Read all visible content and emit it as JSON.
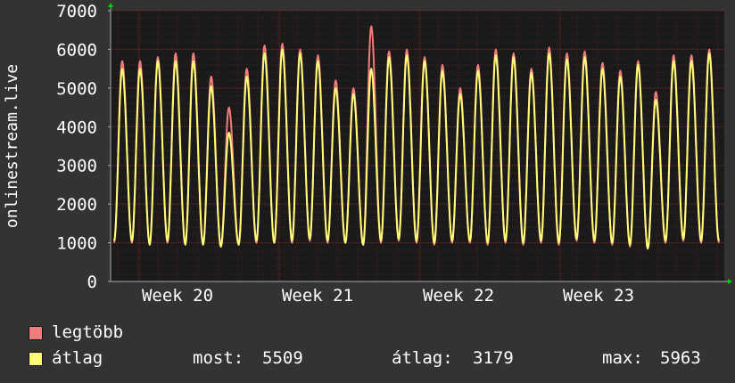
{
  "chart_data": {
    "type": "line",
    "ylabel": "onlinestream.live",
    "ylim": [
      0,
      7000
    ],
    "yticks": [
      0,
      1000,
      2000,
      3000,
      4000,
      5000,
      6000,
      7000
    ],
    "x_tick_labels": [
      "Week 20",
      "Week 21",
      "Week 22",
      "Week 23"
    ],
    "grid": true,
    "colors": {
      "legtobb": "#f47b7b",
      "atlag": "#ffff77",
      "background": "#1a1a1a",
      "grid": "#7a2a2a",
      "axis_arrow": "#00cc00"
    },
    "cycles": 34,
    "series": [
      {
        "name": "legtöbb",
        "peaks": [
          5700,
          5700,
          5800,
          5900,
          5900,
          5300,
          4500,
          5500,
          6100,
          6150,
          6000,
          5850,
          5200,
          5000,
          6600,
          5950,
          6000,
          5800,
          5600,
          5000,
          5600,
          6000,
          5900,
          5500,
          6050,
          5900,
          5950,
          5650,
          5450,
          5700,
          4900,
          5850,
          5850,
          6000
        ],
        "troughs": [
          1000,
          1000,
          950,
          1000,
          950,
          950,
          900,
          950,
          1000,
          1000,
          1000,
          1050,
          1000,
          1000,
          950,
          1000,
          1050,
          1000,
          950,
          1000,
          1000,
          950,
          1000,
          950,
          1000,
          950,
          1050,
          1000,
          950,
          900,
          850,
          1000,
          1050,
          1000
        ]
      },
      {
        "name": "átlag",
        "peaks": [
          5500,
          5500,
          5700,
          5700,
          5700,
          5050,
          3850,
          5300,
          5900,
          6000,
          5900,
          5700,
          5000,
          4850,
          5500,
          5800,
          5850,
          5700,
          5450,
          4850,
          5450,
          5850,
          5800,
          5400,
          5900,
          5750,
          5800,
          5500,
          5300,
          5600,
          4700,
          5700,
          5700,
          5900
        ],
        "troughs": [
          1050,
          1050,
          950,
          1050,
          950,
          950,
          900,
          950,
          1050,
          1000,
          1050,
          1100,
          1050,
          1000,
          950,
          1050,
          1100,
          1050,
          1000,
          1050,
          1050,
          1000,
          1050,
          1000,
          1050,
          1000,
          1100,
          1050,
          1000,
          950,
          850,
          1050,
          1100,
          1050
        ]
      }
    ]
  },
  "legend": {
    "items": [
      {
        "label": "legtöbb",
        "color": "#f47b7b"
      },
      {
        "label": "átlag",
        "color": "#ffff77"
      }
    ],
    "stats": {
      "most_label": "most:",
      "most_value": "5509",
      "atlag_label": "átlag:",
      "atlag_value": "3179",
      "max_label": "max:",
      "max_value": "5963"
    }
  }
}
